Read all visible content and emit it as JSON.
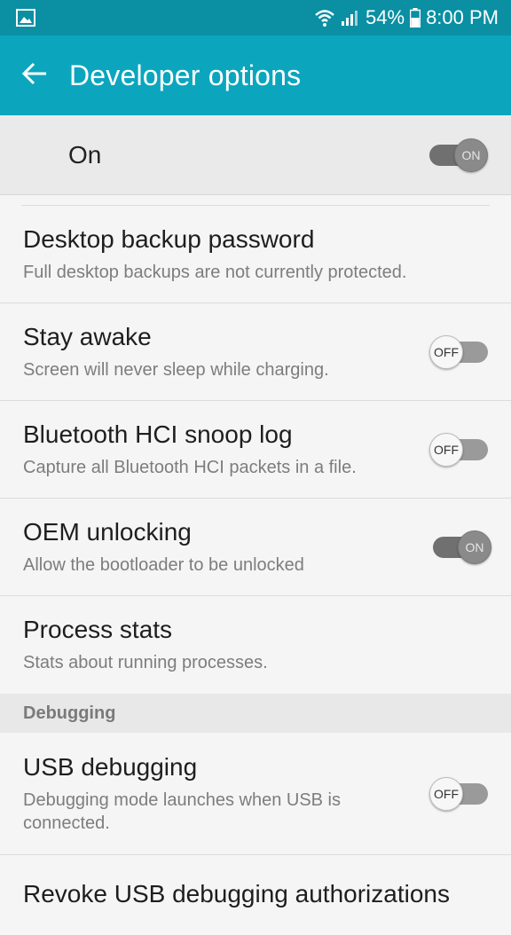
{
  "status_bar": {
    "battery": "54%",
    "time": "8:00 PM",
    "icons": [
      "gallery-icon",
      "wifi-icon",
      "signal-icon",
      "battery-icon"
    ]
  },
  "app_bar": {
    "title": "Developer options",
    "back_icon": "back-arrow-icon"
  },
  "master": {
    "label": "On",
    "toggle": "ON",
    "state": true
  },
  "items": [
    {
      "title": "Desktop backup password",
      "subtitle": "Full desktop backups are not currently protected."
    },
    {
      "title": "Stay awake",
      "subtitle": "Screen will never sleep while charging.",
      "toggle": "OFF",
      "state": false
    },
    {
      "title": "Bluetooth HCI snoop log",
      "subtitle": "Capture all Bluetooth HCI packets in a file.",
      "toggle": "OFF",
      "state": false
    },
    {
      "title": "OEM unlocking",
      "subtitle": "Allow the bootloader to be unlocked",
      "toggle": "ON",
      "state": true
    },
    {
      "title": "Process stats",
      "subtitle": "Stats about running processes."
    }
  ],
  "debugging": {
    "header": "Debugging",
    "usb_debugging": {
      "title": "USB debugging",
      "subtitle": "Debugging mode launches when USB is connected.",
      "toggle": "OFF",
      "state": false
    },
    "revoke": {
      "title": "Revoke USB debugging authorizations"
    }
  },
  "colors": {
    "status_bar": "#0a8fa3",
    "app_bar": "#0ba6be"
  }
}
